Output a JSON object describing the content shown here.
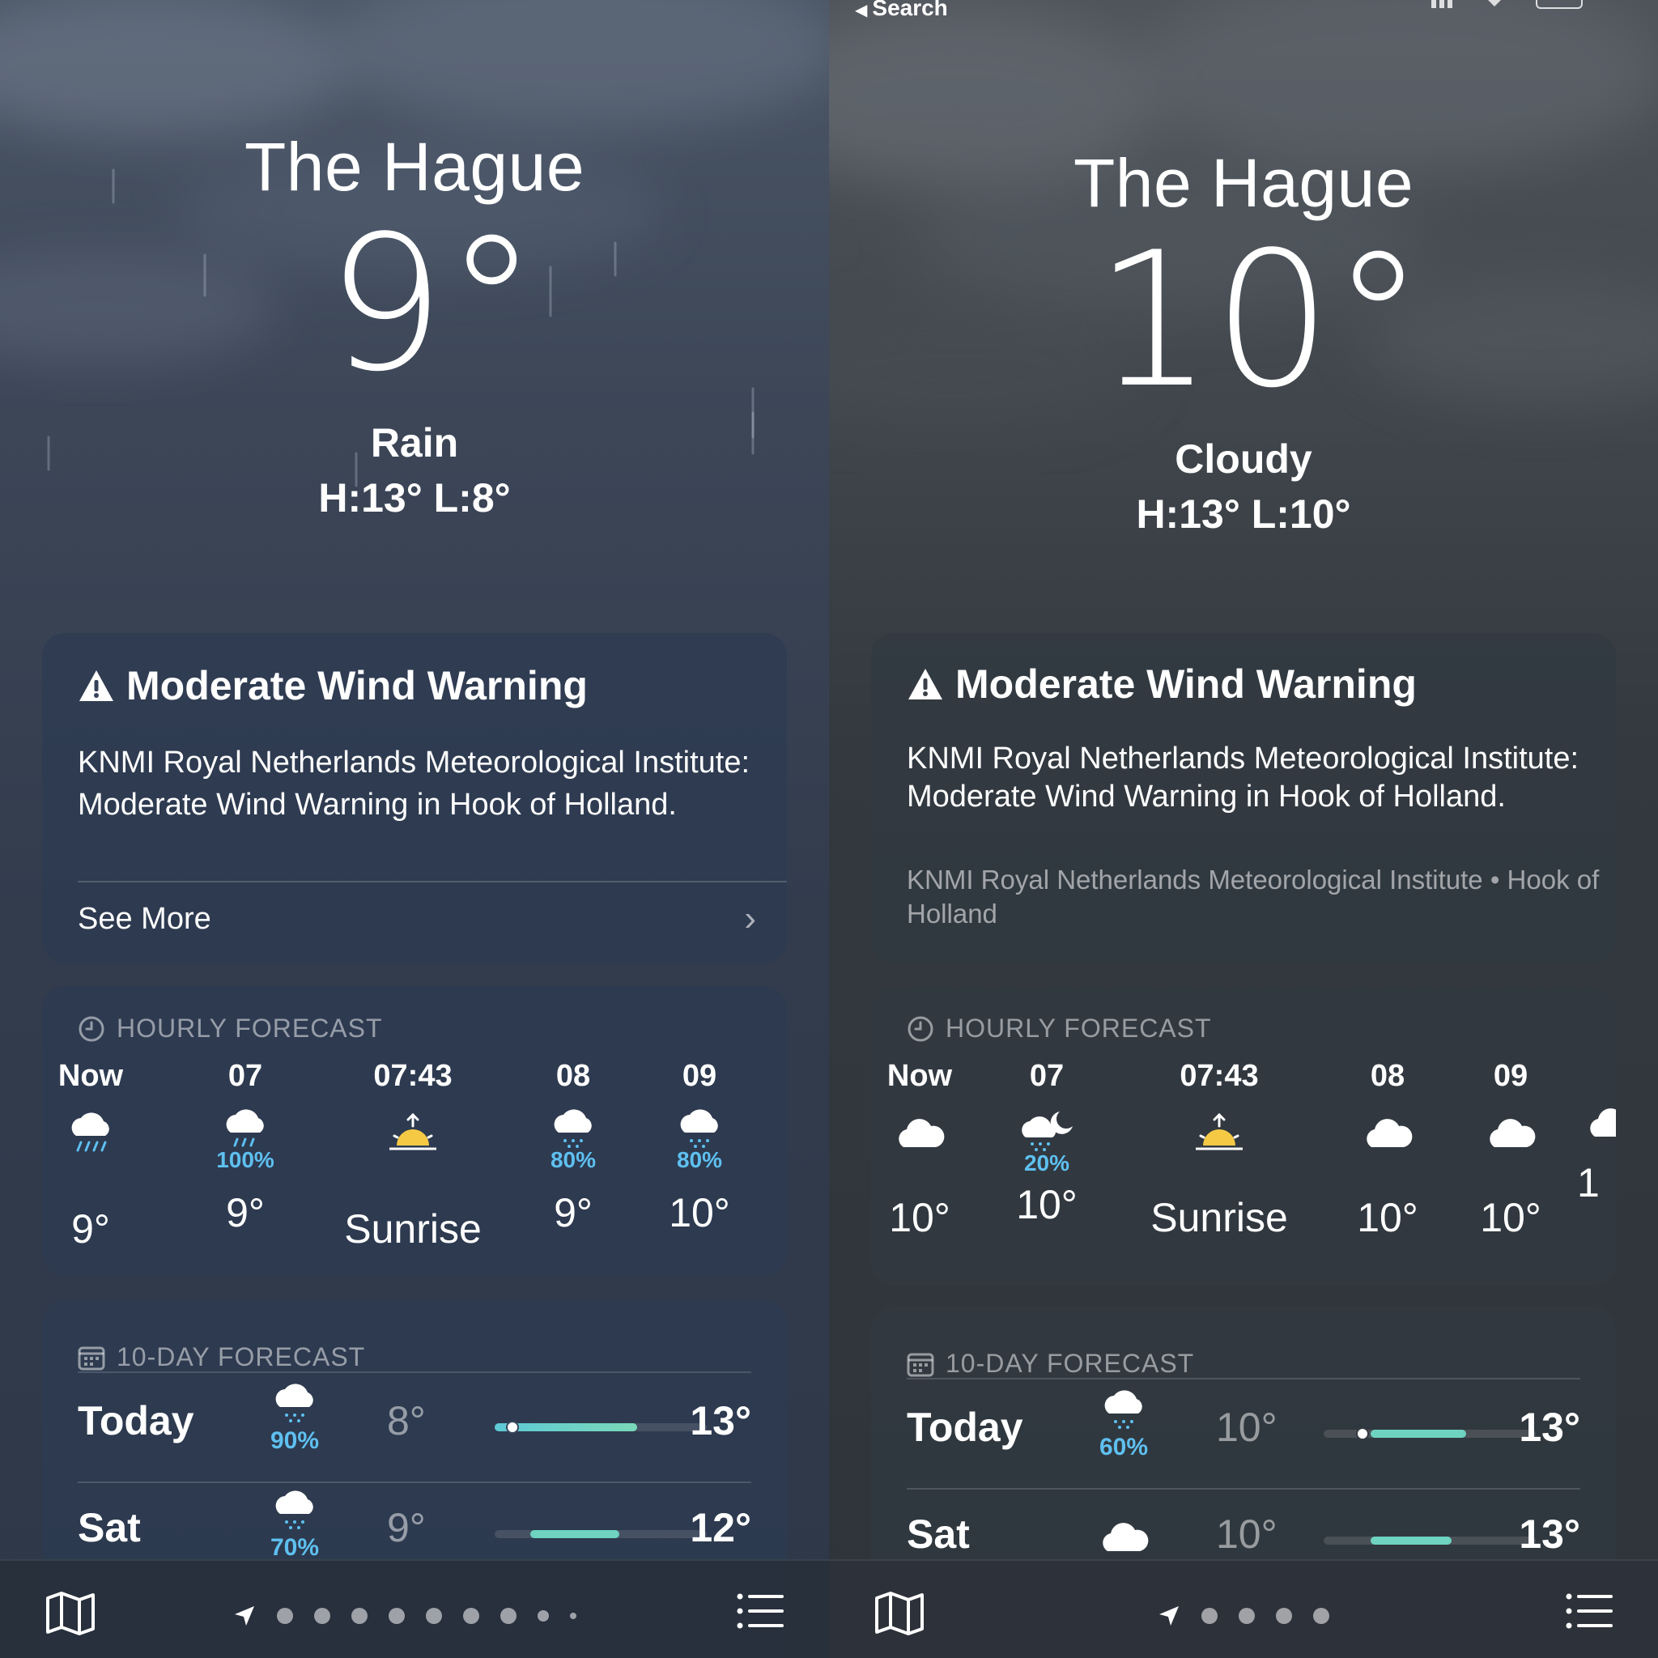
{
  "left": {
    "city": "The Hague",
    "temperature": "9°",
    "condition": "Rain",
    "high_low": "H:13°  L:8°",
    "alert": {
      "title": "Moderate Wind Warning",
      "body": "KNMI Royal Netherlands Meteorological Institute: Moderate Wind Warning in Hook of Holland.",
      "see_more": "See More"
    },
    "hourly": {
      "header": "HOURLY FORECAST",
      "items": [
        {
          "time": "Now",
          "icon": "rain-cloud-icon",
          "precip": "",
          "value": "9°"
        },
        {
          "time": "07",
          "icon": "rain-cloud-icon",
          "precip": "100%",
          "value": "9°"
        },
        {
          "time": "07:43",
          "icon": "sunrise-icon",
          "precip": "",
          "value": "Sunrise"
        },
        {
          "time": "08",
          "icon": "drizzle-cloud-icon",
          "precip": "80%",
          "value": "9°"
        },
        {
          "time": "09",
          "icon": "drizzle-cloud-icon",
          "precip": "80%",
          "value": "10°"
        }
      ]
    },
    "daily": {
      "header": "10-DAY FORECAST",
      "items": [
        {
          "day": "Today",
          "icon": "drizzle-cloud-icon",
          "precip": "90%",
          "low": "8°",
          "high": "13°"
        },
        {
          "day": "Sat",
          "icon": "drizzle-cloud-icon",
          "precip": "70%",
          "low": "9°",
          "high": "12°"
        }
      ]
    }
  },
  "right": {
    "back_label": "Search",
    "city": "The Hague",
    "temperature": "10°",
    "condition": "Cloudy",
    "high_low": "H:13°  L:10°",
    "alert": {
      "title": "Moderate Wind Warning",
      "body": "KNMI Royal Netherlands Meteorological Institute: Moderate Wind Warning in Hook of Holland.",
      "source": "KNMI Royal Netherlands Meteorological Institute • Hook of Holland"
    },
    "hourly": {
      "header": "HOURLY FORECAST",
      "items": [
        {
          "time": "Now",
          "icon": "cloud-icon",
          "precip": "",
          "value": "10°"
        },
        {
          "time": "07",
          "icon": "cloud-moon-rain-icon",
          "precip": "20%",
          "value": "10°"
        },
        {
          "time": "07:43",
          "icon": "sunrise-icon",
          "precip": "",
          "value": "Sunrise"
        },
        {
          "time": "08",
          "icon": "cloud-icon",
          "precip": "",
          "value": "10°"
        },
        {
          "time": "09",
          "icon": "cloud-icon",
          "precip": "",
          "value": "10°"
        },
        {
          "time": "",
          "icon": "cloud-icon",
          "precip": "",
          "value": "1"
        }
      ]
    },
    "daily": {
      "header": "10-DAY FORECAST",
      "items": [
        {
          "day": "Today",
          "icon": "drizzle-cloud-icon",
          "precip": "60%",
          "low": "10°",
          "high": "13°"
        },
        {
          "day": "Sat",
          "icon": "cloud-icon",
          "precip": "",
          "low": "10°",
          "high": "13°"
        }
      ]
    }
  }
}
